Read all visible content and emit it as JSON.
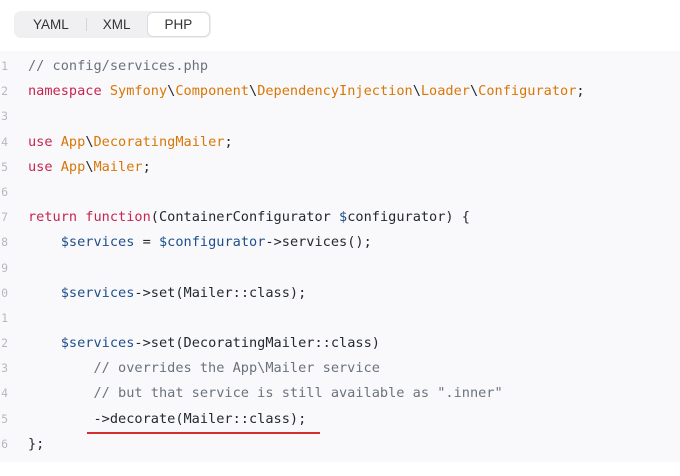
{
  "tabs": [
    {
      "label": "YAML",
      "active": false
    },
    {
      "label": "XML",
      "active": false
    },
    {
      "label": "PHP",
      "active": true
    }
  ],
  "code": {
    "lines": [
      {
        "num": "1",
        "parts": [
          {
            "t": "// config/services.php",
            "c": "cm"
          }
        ]
      },
      {
        "num": "2",
        "parts": [
          {
            "t": "namespace ",
            "c": "kw"
          },
          {
            "t": "Symfony",
            "c": "ns"
          },
          {
            "t": "\\",
            "c": "pl"
          },
          {
            "t": "Component",
            "c": "ns"
          },
          {
            "t": "\\",
            "c": "pl"
          },
          {
            "t": "DependencyInjection",
            "c": "ns"
          },
          {
            "t": "\\",
            "c": "pl"
          },
          {
            "t": "Loader",
            "c": "ns"
          },
          {
            "t": "\\",
            "c": "pl"
          },
          {
            "t": "Configurator",
            "c": "ns"
          },
          {
            "t": ";",
            "c": "pl"
          }
        ]
      },
      {
        "num": "3",
        "parts": []
      },
      {
        "num": "4",
        "parts": [
          {
            "t": "use ",
            "c": "kw"
          },
          {
            "t": "App",
            "c": "ns"
          },
          {
            "t": "\\",
            "c": "pl"
          },
          {
            "t": "DecoratingMailer",
            "c": "ns"
          },
          {
            "t": ";",
            "c": "pl"
          }
        ]
      },
      {
        "num": "5",
        "parts": [
          {
            "t": "use ",
            "c": "kw"
          },
          {
            "t": "App",
            "c": "ns"
          },
          {
            "t": "\\",
            "c": "pl"
          },
          {
            "t": "Mailer",
            "c": "ns"
          },
          {
            "t": ";",
            "c": "pl"
          }
        ]
      },
      {
        "num": "6",
        "parts": []
      },
      {
        "num": "7",
        "parts": [
          {
            "t": "return ",
            "c": "kw"
          },
          {
            "t": "function",
            "c": "kw"
          },
          {
            "t": "(ContainerConfigurator ",
            "c": "pl"
          },
          {
            "t": "$",
            "c": "var"
          },
          {
            "t": "configurator) {",
            "c": "pl"
          }
        ]
      },
      {
        "num": "8",
        "parts": [
          {
            "t": "    ",
            "c": "pl"
          },
          {
            "t": "$services",
            "c": "var"
          },
          {
            "t": " = ",
            "c": "pl"
          },
          {
            "t": "$configurator",
            "c": "var"
          },
          {
            "t": "->services();",
            "c": "pl"
          }
        ]
      },
      {
        "num": "9",
        "parts": []
      },
      {
        "num": "0",
        "parts": [
          {
            "t": "    ",
            "c": "pl"
          },
          {
            "t": "$services",
            "c": "var"
          },
          {
            "t": "->set(Mailer::class);",
            "c": "pl"
          }
        ]
      },
      {
        "num": "1",
        "parts": []
      },
      {
        "num": "2",
        "parts": [
          {
            "t": "    ",
            "c": "pl"
          },
          {
            "t": "$services",
            "c": "var"
          },
          {
            "t": "->set(DecoratingMailer::class)",
            "c": "pl"
          }
        ]
      },
      {
        "num": "3",
        "parts": [
          {
            "t": "        // overrides the App\\Mailer service",
            "c": "cm"
          }
        ]
      },
      {
        "num": "4",
        "parts": [
          {
            "t": "        // but that service is still available as \".inner\"",
            "c": "cm"
          }
        ]
      },
      {
        "num": "5",
        "parts": [
          {
            "t": "        ->decorate(Mailer::class);",
            "c": "pl"
          }
        ]
      },
      {
        "num": "6",
        "parts": [
          {
            "t": "};",
            "c": "pl"
          }
        ]
      }
    ]
  },
  "colors": {
    "keyword": "#c7254e",
    "namespace": "#d97706",
    "comment": "#6a737d",
    "variable": "#1e4e8c",
    "highlight_underline": "#d32f2f"
  }
}
